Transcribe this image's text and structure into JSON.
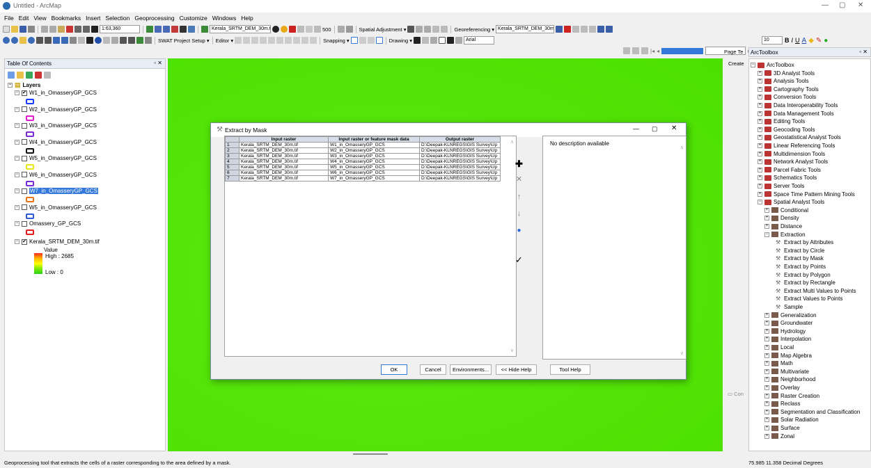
{
  "window": {
    "title": "Untitled - ArcMap"
  },
  "menu": [
    "File",
    "Edit",
    "View",
    "Bookmarks",
    "Insert",
    "Selection",
    "Geoprocessing",
    "Customize",
    "Windows",
    "Help"
  ],
  "toolbar": {
    "scale": "1:63,360",
    "layer_combo": "Kerala_SRTM_DEM_30m.tif",
    "value_500": "500",
    "spatial_adjustment": "Spatial Adjustment ▾",
    "georeferencing": "Georeferencing ▾",
    "georef_layer": "Kerala_SRTM_DEM_30m.tif",
    "font_size": "10",
    "swat": "SWAT Project Setup ▾",
    "editor": "Editor ▾",
    "snapping": "Snapping ▾",
    "drawing": "Drawing ▾",
    "font": "Arial"
  },
  "toc": {
    "title": "Table Of Contents",
    "group": "Layers",
    "layers": [
      {
        "name": "W1_in_OmasseryGP_GCS",
        "checked": true,
        "color": "#1a3cff"
      },
      {
        "name": "W2_in_OmasseryGP_GCS",
        "checked": false,
        "color": "#e21ccc"
      },
      {
        "name": "W3_in_OmasseryGP_GCS",
        "checked": false,
        "color": "#7a2ad6"
      },
      {
        "name": "W4_in_OmasseryGP_GCS",
        "checked": false,
        "color": "#111111"
      },
      {
        "name": "W5_in_OmasseryGP_GCS",
        "checked": false,
        "color": "#e8e81a"
      },
      {
        "name": "W6_in_OmasseryGP_GCS",
        "checked": false,
        "color": "#7a2ad6"
      },
      {
        "name": "W7_in_OmasseryGP_GCS",
        "checked": false,
        "color": "#e8741a",
        "selected": true
      },
      {
        "name": "W5_in_OmasseryGP_GCS",
        "checked": false,
        "color": "#2a5ad6"
      },
      {
        "name": "Omassery_GP_GCS",
        "checked": false,
        "color": "#e01a1a"
      }
    ],
    "raster": {
      "name": "Kerala_SRTM_DEM_30m.tif",
      "checked": true,
      "value_label": "Value",
      "high": "High : 2685",
      "low": "Low : 0"
    }
  },
  "dialog": {
    "title": "Extract by Mask",
    "columns": [
      "Input raster",
      "Input raster or feature mask data",
      "Output raster"
    ],
    "rows": [
      [
        "1",
        "Kerala_SRTM_DEM_30m.tif",
        "W1_in_OmasseryGP_GCS",
        "D:\\Deepak-KLNREGS\\GIS Survey\\Up"
      ],
      [
        "2",
        "Kerala_SRTM_DEM_30m.tif",
        "W2_in_OmasseryGP_GCS",
        "D:\\Deepak-KLNREGS\\GIS Survey\\Up"
      ],
      [
        "3",
        "Kerala_SRTM_DEM_30m.tif",
        "W3_in_OmasseryGP_GCS",
        "D:\\Deepak-KLNREGS\\GIS Survey\\Up"
      ],
      [
        "4",
        "Kerala_SRTM_DEM_30m.tif",
        "W4_in_OmasseryGP_GCS",
        "D:\\Deepak-KLNREGS\\GIS Survey\\Up"
      ],
      [
        "5",
        "Kerala_SRTM_DEM_30m.tif",
        "W5_in_OmasseryGP_GCS",
        "D:\\Deepak-KLNREGS\\GIS Survey\\Up"
      ],
      [
        "6",
        "Kerala_SRTM_DEM_30m.tif",
        "W6_in_OmasseryGP_GCS",
        "D:\\Deepak-KLNREGS\\GIS Survey\\Up"
      ],
      [
        "7",
        "Kerala_SRTM_DEM_30m.tif",
        "W7_in_OmasseryGP_GCS",
        "D:\\Deepak-KLNREGS\\GIS Survey\\Up"
      ]
    ],
    "description": "No description available",
    "buttons": {
      "ok": "OK",
      "cancel": "Cancel",
      "environments": "Environments...",
      "hide_help": "<< Hide Help",
      "tool_help": "Tool Help"
    }
  },
  "toolbox": {
    "tab": "ArcToolbox",
    "side_tab_create": "Create",
    "side_tab_page": "Page Te",
    "root": "ArcToolbox",
    "toolboxes": [
      "3D Analyst Tools",
      "Analysis Tools",
      "Cartography Tools",
      "Conversion Tools",
      "Data Interoperability Tools",
      "Data Management Tools",
      "Editing Tools",
      "Geocoding Tools",
      "Geostatistical Analyst Tools",
      "Linear Referencing Tools",
      "Multidimension Tools",
      "Network Analyst Tools",
      "Parcel Fabric Tools",
      "Schematics Tools",
      "Server Tools",
      "Space Time Pattern Mining Tools",
      "Spatial Analyst Tools"
    ],
    "spatial_before": [
      "Conditional",
      "Density",
      "Distance",
      "Extraction"
    ],
    "extraction_tools": [
      "Extract by Attributes",
      "Extract by Circle",
      "Extract by Mask",
      "Extract by Points",
      "Extract by Polygon",
      "Extract by Rectangle",
      "Extract Multi Values to Points",
      "Extract Values to Points",
      "Sample"
    ],
    "spatial_after": [
      "Generalization",
      "Groundwater",
      "Hydrology",
      "Interpolation",
      "Local",
      "Map Algebra",
      "Math",
      "Multivariate",
      "Neighborhood",
      "Overlay",
      "Raster Creation",
      "Reclass",
      "Segmentation and Classification",
      "Solar Radiation",
      "Surface",
      "Zonal"
    ]
  },
  "status": {
    "message": "Geoprocessing tool that extracts the cells of a raster corresponding to the area defined by a mask.",
    "coords": "75.985  11.358 Decimal Degrees"
  }
}
